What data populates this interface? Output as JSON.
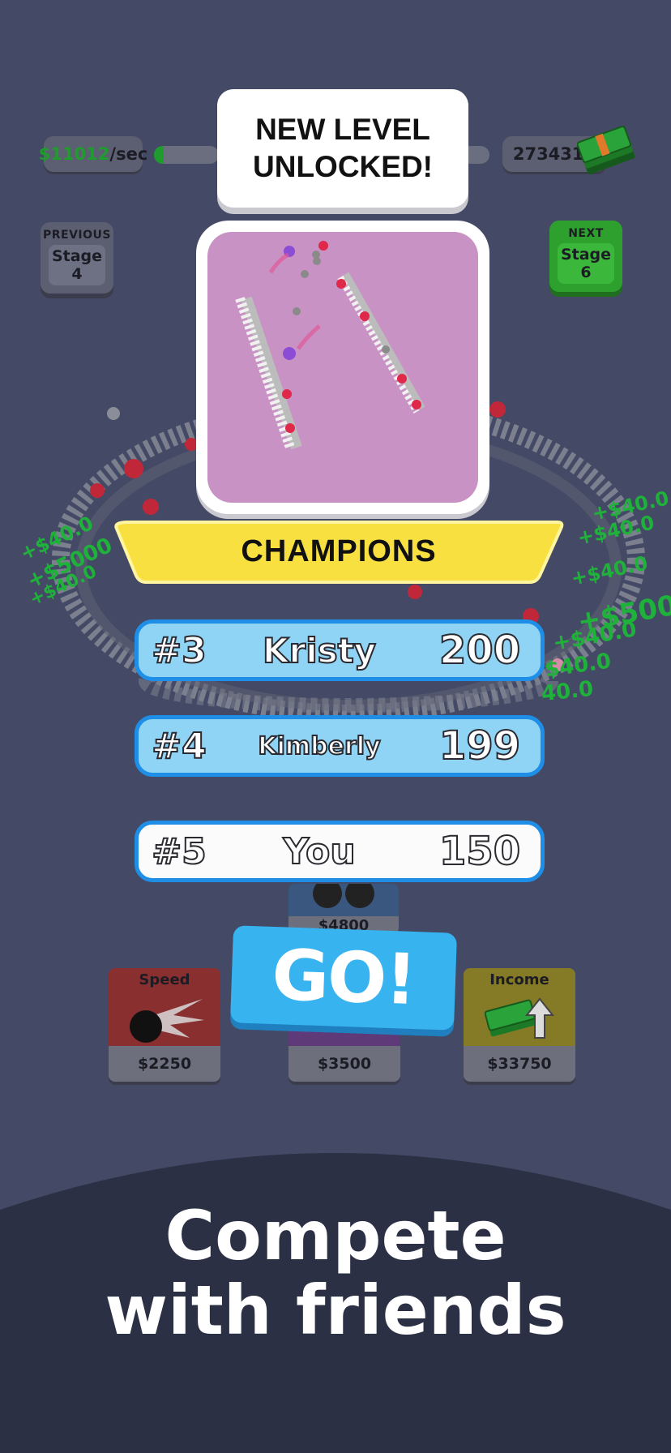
{
  "hud": {
    "income_value": "$11012",
    "income_unit": "/sec",
    "money": "2734315",
    "income_progress": 0.15
  },
  "stages": {
    "previous_caption": "PREVIOUS",
    "previous_label": "Stage",
    "previous_number": "4",
    "next_caption": "NEXT",
    "next_label": "Stage",
    "next_number": "6"
  },
  "banner": {
    "line1": "NEW LEVEL",
    "line2": "UNLOCKED!"
  },
  "champions_title": "CHAMPIONS",
  "leaderboard": [
    {
      "rank": "#3",
      "name": "Kristy",
      "score": "200"
    },
    {
      "rank": "#4",
      "name": "Kimberly",
      "score": "199"
    },
    {
      "rank": "#5",
      "name": "You",
      "score": "150"
    }
  ],
  "upgrades": {
    "back_price": "$4800",
    "speed_title": "Speed",
    "speed_price": "$2250",
    "mid_price": "$3500",
    "income_title": "Income",
    "income_price": "$33750"
  },
  "go_label": "GO!",
  "floating_income": [
    "+$40.0",
    "+$40.0",
    "+$40.0",
    "+$5000",
    "+$40.0",
    "$40.0",
    "40.0"
  ],
  "promo": {
    "line1": "Compete",
    "line2": "with friends"
  },
  "colors": {
    "background": "#444a66",
    "accent_green": "#1f9d2c",
    "go_blue": "#37b3f0",
    "champions_yellow": "#f7e040",
    "row_border": "#1f8ee6"
  }
}
